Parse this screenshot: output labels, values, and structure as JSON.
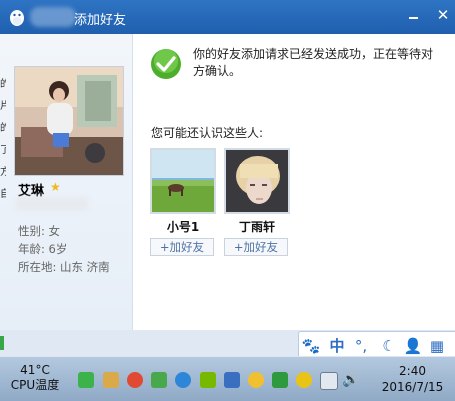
{
  "window": {
    "title": "添加好友",
    "title_visible": "添加好友"
  },
  "profile": {
    "nickname": "艾琳",
    "gender": "性别: 女",
    "age": "年龄: 6岁",
    "location": "所在地: 山东  济南"
  },
  "message": {
    "success": "你的好友添加请求已经发送成功，正在等待对方确认。"
  },
  "suggestions": {
    "heading": "您可能还认识这些人:",
    "people": [
      {
        "name": "小号1",
        "add_label": "+加好友"
      },
      {
        "name": "丁雨轩",
        "add_label": "+加好友"
      }
    ]
  },
  "ime": {
    "mode": "中"
  },
  "taskbar": {
    "temperature": "41°C",
    "cpu_label": "CPU温度",
    "time": "2:40",
    "date": "2016/7/15"
  },
  "colors": {
    "title_bar": "#1f5fae",
    "accent": "#2c6ec3",
    "taskbar": "#a6bdd6"
  }
}
